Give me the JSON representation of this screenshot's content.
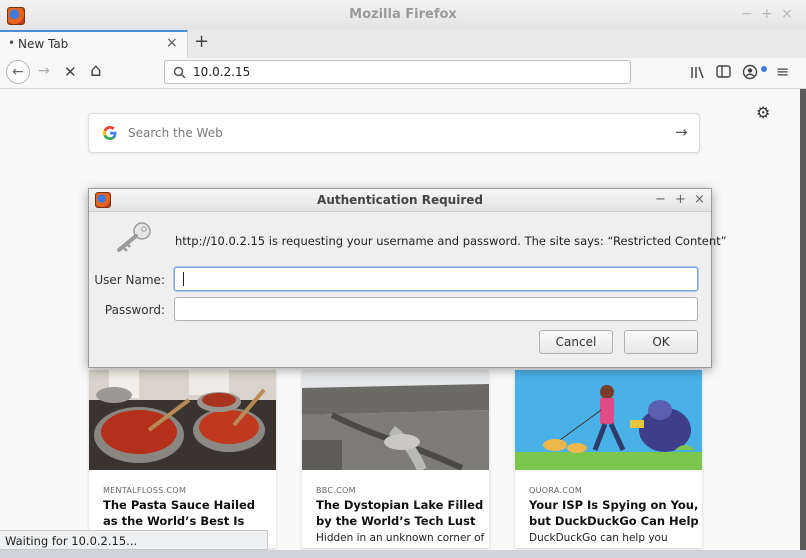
{
  "window": {
    "title": "Mozilla Firefox",
    "min_glyph": "−",
    "max_glyph": "+",
    "close_glyph": "×"
  },
  "tab": {
    "label": "New Tab",
    "dot": "•",
    "close_glyph": "×",
    "new_glyph": "+"
  },
  "nav": {
    "url": "10.0.2.15",
    "back_glyph": "←",
    "forward_glyph": "→",
    "stop_glyph": "✕",
    "home_glyph": "⌂",
    "menu_glyph": "≡"
  },
  "newtab": {
    "search_placeholder": "Search the Web",
    "search_arrow": "→",
    "gear_glyph": "⚙"
  },
  "cards": [
    {
      "source": "MENTALFLOSS.COM",
      "title": "The Pasta Sauce Hailed as the World’s Best Is",
      "desc": ""
    },
    {
      "source": "BBC.COM",
      "title": "The Dystopian Lake Filled by the World’s Tech Lust",
      "desc": "Hidden in an unknown corner of"
    },
    {
      "source": "QUORA.COM",
      "title": "Your ISP Is Spying on You, but DuckDuckGo Can Help",
      "desc": "DuckDuckGo can help you"
    }
  ],
  "dialog": {
    "title": "Authentication Required",
    "message": "http://10.0.2.15 is requesting your username and password. The site says: “Restricted Content”",
    "username_label": "User Name:",
    "password_label": "Password:",
    "username_value": "",
    "password_value": "",
    "cancel_label": "Cancel",
    "ok_label": "OK",
    "min_glyph": "−",
    "max_glyph": "+",
    "close_glyph": "×"
  },
  "status": {
    "text": "Waiting for 10.0.2.15..."
  }
}
